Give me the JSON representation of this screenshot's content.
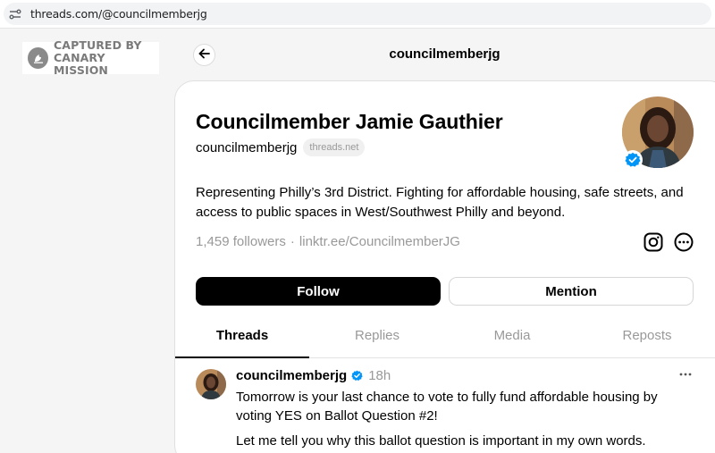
{
  "browser": {
    "url": "threads.com/@councilmemberjg",
    "site_settings_icon": "site-settings-icon"
  },
  "watermark": {
    "line1": "CAPTURED BY",
    "line2": "CANARY MISSION",
    "icon": "canary-logo-icon"
  },
  "header": {
    "title": "councilmemberjg",
    "back_icon": "back-arrow-icon"
  },
  "profile": {
    "display_name": "Councilmember Jamie Gauthier",
    "handle": "councilmemberjg",
    "domain_badge": "threads.net",
    "bio": "Representing Philly’s 3rd District. Fighting for affordable housing, safe streets, and access to public spaces in West/Southwest Philly and beyond.",
    "followers": "1,459 followers",
    "separator": "·",
    "link": "linktr.ee/CouncilmemberJG",
    "verified_icon": "verified-badge-icon",
    "instagram_icon": "instagram-icon",
    "more_icon": "more-options-icon"
  },
  "actions": {
    "follow_label": "Follow",
    "mention_label": "Mention"
  },
  "tabs": [
    {
      "label": "Threads",
      "active": true
    },
    {
      "label": "Replies",
      "active": false
    },
    {
      "label": "Media",
      "active": false
    },
    {
      "label": "Reposts",
      "active": false
    }
  ],
  "post": {
    "user": "councilmemberjg",
    "time": "18h",
    "text_1": "Tomorrow is your last chance to vote to fully fund affordable housing by voting YES on Ballot Question #2!",
    "text_2": "Let me tell you why this ballot question is important in my own words.",
    "more_icon": "post-more-icon"
  },
  "colors": {
    "accent_verified": "#0095f6",
    "follow_bg": "#000000",
    "muted_text": "#999999"
  }
}
